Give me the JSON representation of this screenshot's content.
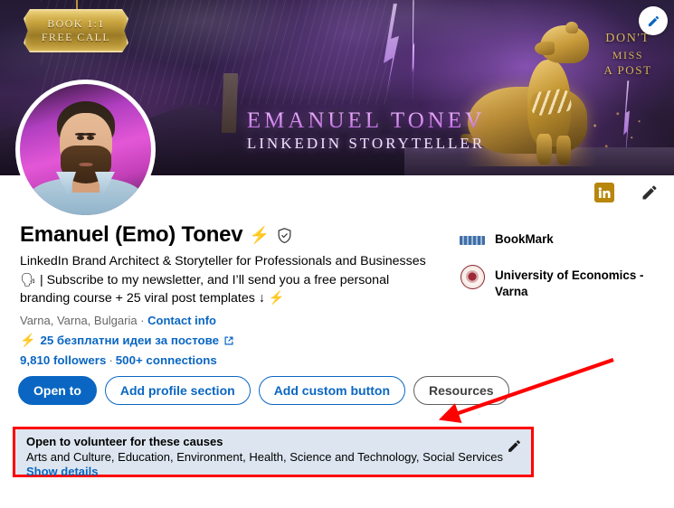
{
  "banner": {
    "plaque_line1": "BOOK 1:1",
    "plaque_line2": "FREE CALL",
    "name": "EMANUEL TONEV",
    "subtitle": "LINKEDIN STORYTELLER",
    "corner_line1": "DON'T",
    "corner_line2": "MISS",
    "corner_line3": "A POST",
    "edit_icon": "pencil-icon",
    "colors": {
      "accent_purple": "#b06ad8",
      "gold": "#c9a43f",
      "sky": "#2b2040"
    }
  },
  "profile": {
    "avatar": "profile-photo",
    "name": "Emanuel (Emo) Tonev",
    "name_badge_icon": "lightning-bolt-icon",
    "verified_icon": "verified-shield-icon",
    "headline_line1": "LinkedIn Brand Architect & Storyteller for Professionals and Businesses",
    "headline_line2": "🗣 | Subscribe to my newsletter, and I’ll send you a free personal",
    "headline_line3": "branding course + 25 viral post templates ↓ ⚡",
    "location": "Varna, Varna, Bulgaria",
    "location_separator": " · ",
    "contact_info": "Contact info",
    "promo_link": "25 безплатни идеи за постове",
    "promo_link_icon": "external-link-icon",
    "followers": "9,810 followers",
    "stats_separator": "·",
    "connections": "500+ connections"
  },
  "top_actions": {
    "linkedin_badge_icon": "linkedin-premium-icon",
    "edit_icon": "pencil-icon"
  },
  "side_panel": {
    "items": [
      {
        "logo": "bookmark-logo-icon",
        "label": "BookMark"
      },
      {
        "logo": "university-crest-icon",
        "label": "University of Economics - Varna"
      }
    ]
  },
  "buttons": [
    {
      "label": "Open to",
      "style": "primary"
    },
    {
      "label": "Add profile section",
      "style": "outline"
    },
    {
      "label": "Add custom button",
      "style": "outline"
    },
    {
      "label": "Resources",
      "style": "gray"
    }
  ],
  "volunteer_card": {
    "title": "Open to volunteer for these causes",
    "causes": "Arts and Culture, Education, Environment, Health, Science and Technology, Social Services",
    "show_details": "Show details",
    "edit_icon": "pencil-icon",
    "highlight_color": "#ff0000",
    "background_color": "#dde6f0"
  },
  "annotation": {
    "arrow": "red-arrow-pointing-to-volunteer-card",
    "color": "#ff0000"
  }
}
